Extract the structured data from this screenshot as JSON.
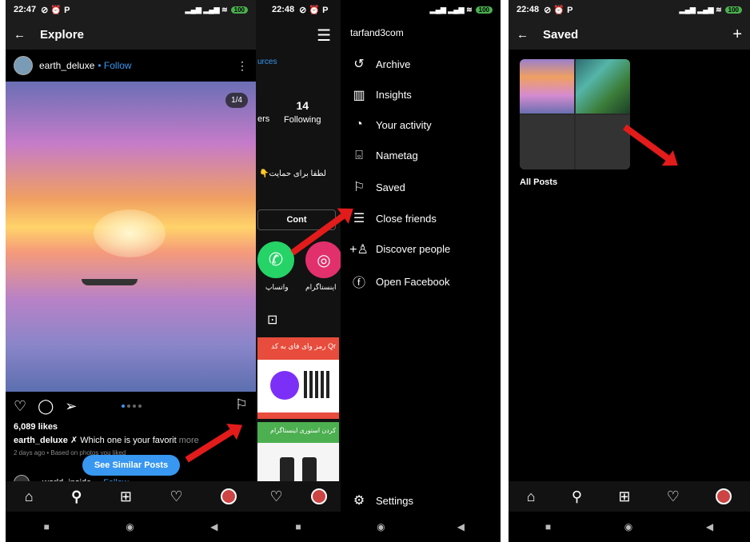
{
  "p1": {
    "status_time": "22:47",
    "status_icons": "⊘ ⏰ P",
    "battery": "100",
    "title": "Explore",
    "post_user": "earth_deluxe",
    "follow": "• Follow",
    "counter": "1/4",
    "likes": "6,089 likes",
    "caption_user": "earth_deluxe",
    "caption_text": "✗ Which one is your favorit",
    "caption_more": "more",
    "meta": "2 days ago • Based on photos you liked",
    "similar_btn": "See Similar Posts",
    "next_user": "world_inside",
    "next_follow": "• Follow"
  },
  "p2": {
    "link": "urces",
    "following_count": "14",
    "following_label": "Following",
    "ers": "ers",
    "rtl_text": "👇لطفا برای حمایت",
    "contact": "Cont",
    "hl1_label": "واتساپ",
    "hl2_label": "اینستاگرام",
    "post1_text": "رمز وای فای به کد Qr",
    "post2_text": "کردن استوری اینستاگرام"
  },
  "p3": {
    "status_time": "22:48",
    "status_icons": "⊘ ⏰ P",
    "battery": "100",
    "username": "tarfand3com",
    "menu": [
      {
        "icon": "archive-icon",
        "glyph": "↺",
        "label": "Archive"
      },
      {
        "icon": "insights-icon",
        "glyph": "▥",
        "label": "Insights"
      },
      {
        "icon": "activity-icon",
        "glyph": "◔",
        "label": "Your activity"
      },
      {
        "icon": "nametag-icon",
        "glyph": "⌻",
        "label": "Nametag"
      },
      {
        "icon": "saved-icon",
        "glyph": "⚐",
        "label": "Saved"
      },
      {
        "icon": "close-friends-icon",
        "glyph": "☰",
        "label": "Close friends"
      },
      {
        "icon": "discover-people-icon",
        "glyph": "+♙",
        "label": "Discover people"
      },
      {
        "icon": "facebook-icon",
        "glyph": "ⓕ",
        "label": "Open Facebook"
      }
    ],
    "settings": "Settings"
  },
  "p4": {
    "status_time": "22:48",
    "status_icons": "⊘ ⏰ P",
    "battery": "100",
    "title": "Saved",
    "collection": "All Posts"
  },
  "colors": {
    "accent": "#3897f0",
    "arrow": "#e21b1b",
    "bg": "#000000"
  }
}
